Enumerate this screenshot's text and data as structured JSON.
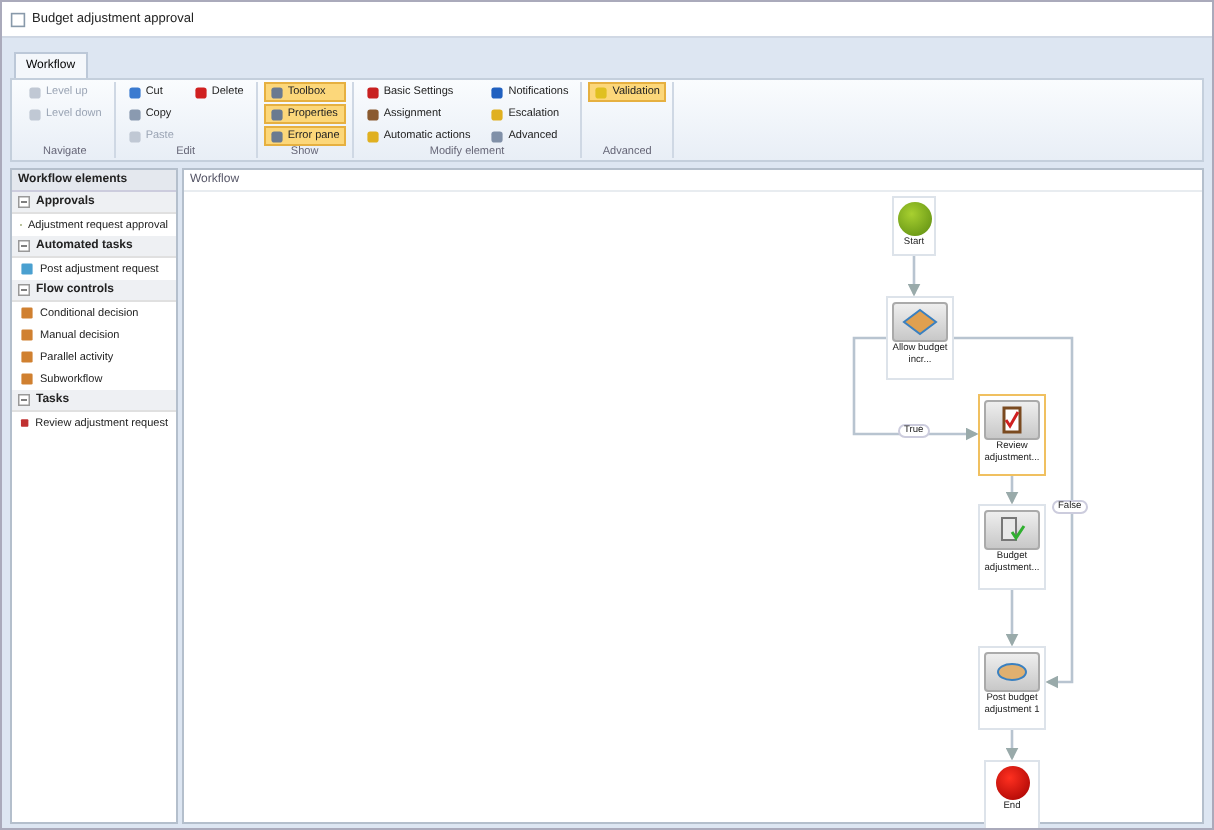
{
  "window": {
    "title": "Budget adjustment approval"
  },
  "tabs": [
    {
      "label": "Workflow",
      "selected": true
    }
  ],
  "ribbon": {
    "groups": [
      {
        "label": "Navigate",
        "items": [
          {
            "label": "Level up",
            "disabled": true,
            "selected": false
          },
          {
            "label": "Level down",
            "disabled": true,
            "selected": false
          }
        ]
      },
      {
        "label": "Edit",
        "items": [
          {
            "label": "Cut",
            "disabled": false,
            "selected": false
          },
          {
            "label": "Copy",
            "disabled": false,
            "selected": false
          },
          {
            "label": "Paste",
            "disabled": true,
            "selected": false
          },
          {
            "label": "Delete",
            "disabled": false,
            "selected": false
          }
        ]
      },
      {
        "label": "Show",
        "items": [
          {
            "label": "Toolbox",
            "disabled": false,
            "selected": true
          },
          {
            "label": "Properties",
            "disabled": false,
            "selected": true
          },
          {
            "label": "Error pane",
            "disabled": false,
            "selected": true
          }
        ]
      },
      {
        "label": "Modify element",
        "items": [
          {
            "label": "Basic Settings",
            "disabled": false,
            "selected": false
          },
          {
            "label": "Assignment",
            "disabled": false,
            "selected": false
          },
          {
            "label": "Automatic actions",
            "disabled": false,
            "selected": false
          },
          {
            "label": "Notifications",
            "disabled": false,
            "selected": false
          },
          {
            "label": "Escalation",
            "disabled": false,
            "selected": false
          },
          {
            "label": "Advanced",
            "disabled": false,
            "selected": false
          }
        ]
      },
      {
        "label": "Advanced",
        "items": [
          {
            "label": "Validation",
            "disabled": false,
            "selected": true
          }
        ]
      }
    ]
  },
  "sidebar": {
    "title": "Workflow elements",
    "sections": [
      {
        "label": "Approvals",
        "expanded": true,
        "items": [
          "Adjustment request approval"
        ]
      },
      {
        "label": "Automated tasks",
        "expanded": true,
        "items": [
          "Post adjustment request"
        ]
      },
      {
        "label": "Flow controls",
        "expanded": true,
        "items": [
          "Conditional decision",
          "Manual decision",
          "Parallel activity",
          "Subworkflow"
        ]
      },
      {
        "label": "Tasks",
        "expanded": true,
        "items": [
          "Review adjustment request"
        ]
      }
    ]
  },
  "canvas": {
    "title": "Workflow",
    "nodes": [
      {
        "kind": "start",
        "label": "Start",
        "selected": false
      },
      {
        "kind": "decision",
        "label": "Allow budget incr...",
        "selected": false
      },
      {
        "kind": "task",
        "label": "Review adjustment...",
        "selected": true
      },
      {
        "kind": "approval",
        "label": "Budget adjustment...",
        "selected": false
      },
      {
        "kind": "automated",
        "label": "Post budget adjustment 1",
        "selected": false
      },
      {
        "kind": "end",
        "label": "End",
        "selected": false
      }
    ],
    "branch_labels": [
      "True",
      "False"
    ]
  }
}
